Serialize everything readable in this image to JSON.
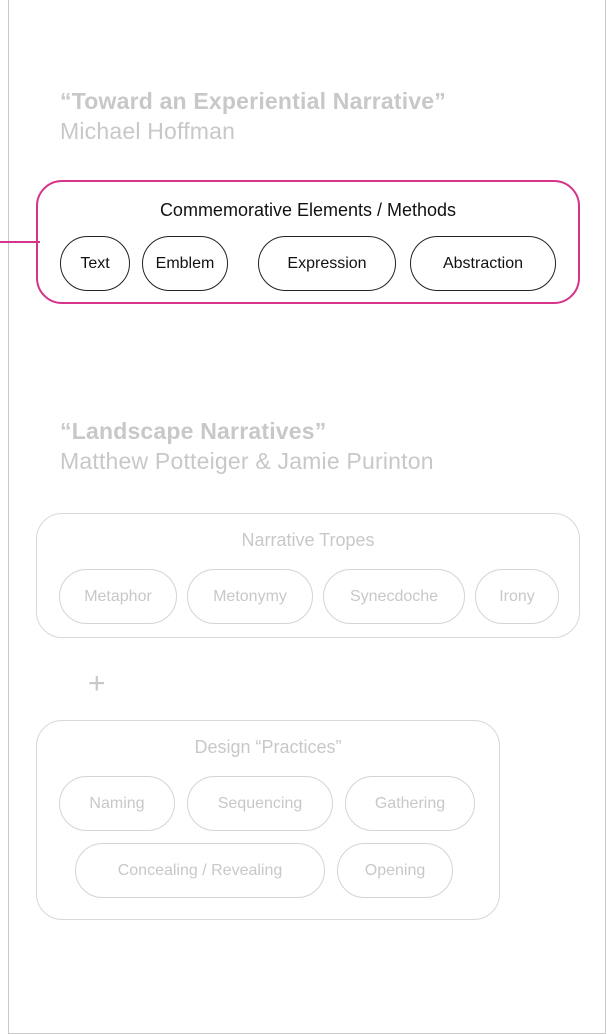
{
  "sources": [
    {
      "title": "“Toward an Experiential Narrative”",
      "author": "Michael Hoffman"
    },
    {
      "title": "“Landscape Narratives”",
      "author": "Matthew Potteiger & Jamie Purinton"
    }
  ],
  "commemorative": {
    "heading": "Commemorative Elements / Methods",
    "items": [
      "Text",
      "Emblem",
      "Expression",
      "Abstraction"
    ],
    "accent_color": "#d6338a"
  },
  "tropes": {
    "heading": "Narrative Tropes",
    "items": [
      "Metaphor",
      "Metonymy",
      "Synecdoche",
      "Irony"
    ]
  },
  "combinator": "+",
  "practices": {
    "heading": "Design “Practices”",
    "items": [
      "Naming",
      "Sequencing",
      "Gathering",
      "Concealing / Revealing",
      "Opening"
    ]
  }
}
